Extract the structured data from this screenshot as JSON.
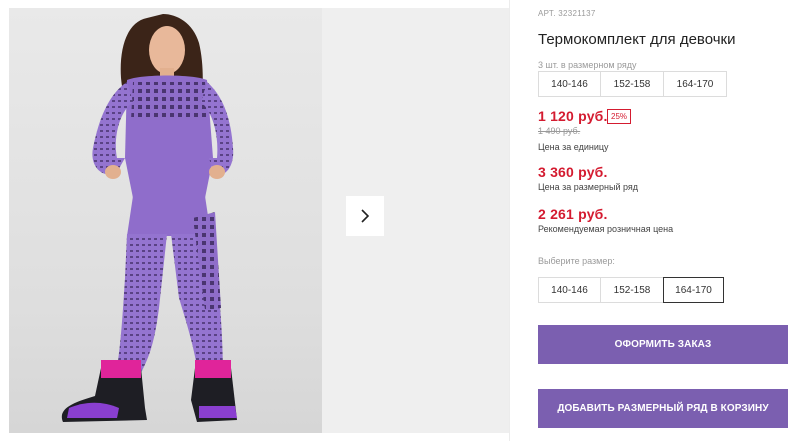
{
  "product": {
    "article": "АРТ. 32321137",
    "title": "Термокомплект для девочки",
    "pack_label": "3 шт. в размерном ряду",
    "pack_sizes": [
      "140-146",
      "152-158",
      "164-170"
    ],
    "price": "1 120 руб.",
    "discount_badge": "25%",
    "old_price": "1 490 руб.",
    "price_unit_note": "Цена за единицу",
    "row_price": "3 360 руб.",
    "row_price_note": "Цена за размерный ряд",
    "retail_price": "2 261 руб.",
    "retail_price_note": "Рекомендуемая розничная цена",
    "choose_size_label": "Выберите размер:",
    "size_options": [
      "140-146",
      "152-158",
      "164-170"
    ],
    "selected_size": "164-170"
  },
  "actions": {
    "order_button": "ОФОРМИТЬ ЗАКАЗ",
    "add_row_button": "ДОБАВИТЬ РАЗМЕРНЫЙ РЯД В КОРЗИНУ"
  },
  "colors": {
    "accent": "#7b5fb0",
    "price_red": "#d41b30"
  },
  "icons": {
    "next_arrow": "chevron-right-icon"
  }
}
